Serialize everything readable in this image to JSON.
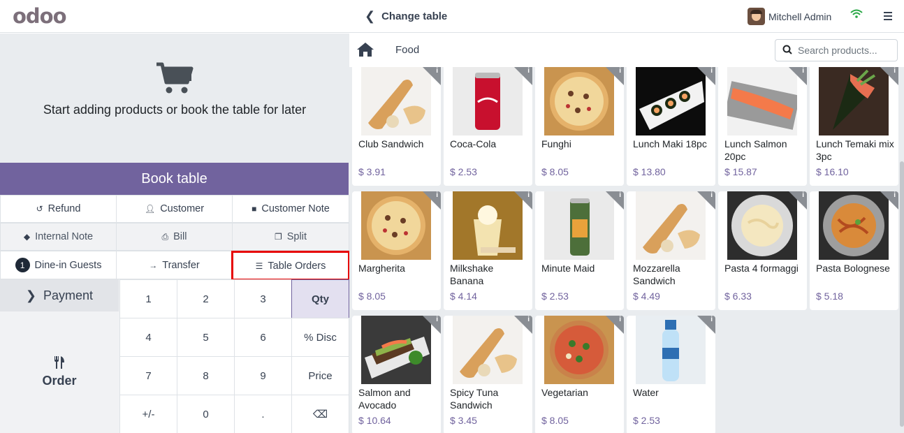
{
  "topbar": {
    "logo": "odoo",
    "change_table": "Change table",
    "user_name": "Mitchell Admin"
  },
  "empty_state": {
    "message": "Start adding products or book the table for later"
  },
  "book_table_label": "Book table",
  "controls": {
    "refund": "Refund",
    "customer": "Customer",
    "customer_note": "Customer Note",
    "internal_note": "Internal Note",
    "bill": "Bill",
    "split": "Split",
    "guests_count": "1",
    "dine_in_guests": "Dine-in Guests",
    "transfer": "Transfer",
    "table_orders": "Table Orders"
  },
  "payment_label": "Payment",
  "order_label": "Order",
  "numpad": {
    "keys": [
      "1",
      "2",
      "3",
      "Qty",
      "4",
      "5",
      "6",
      "% Disc",
      "7",
      "8",
      "9",
      "Price",
      "+/-",
      "0",
      ".",
      "⌫"
    ],
    "active_mode": "Qty"
  },
  "category": {
    "current": "Food"
  },
  "search": {
    "placeholder": "Search products..."
  },
  "colors": {
    "accent": "#71639e",
    "highlight_border": "#e60000",
    "wifi": "#28a745"
  },
  "products": [
    {
      "name": "Club Sandwich",
      "price": "$ 3.91",
      "img": "sandwich"
    },
    {
      "name": "Coca-Cola",
      "price": "$ 2.53",
      "img": "can-red"
    },
    {
      "name": "Funghi",
      "price": "$ 8.05",
      "img": "pizza"
    },
    {
      "name": "Lunch Maki 18pc",
      "price": "$ 13.80",
      "img": "sushi"
    },
    {
      "name": "Lunch Salmon 20pc",
      "price": "$ 15.87",
      "img": "salmon"
    },
    {
      "name": "Lunch Temaki mix 3pc",
      "price": "$ 16.10",
      "img": "temaki"
    },
    {
      "name": "Margherita",
      "price": "$ 8.05",
      "img": "pizza"
    },
    {
      "name": "Milkshake Banana",
      "price": "$ 4.14",
      "img": "milkshake"
    },
    {
      "name": "Minute Maid",
      "price": "$ 2.53",
      "img": "can-green"
    },
    {
      "name": "Mozzarella Sandwich",
      "price": "$ 4.49",
      "img": "sandwich"
    },
    {
      "name": "Pasta 4 formaggi",
      "price": "$ 6.33",
      "img": "pasta"
    },
    {
      "name": "Pasta Bolognese",
      "price": "$ 5.18",
      "img": "pasta-red"
    },
    {
      "name": "Salmon and Avocado",
      "price": "$ 10.64",
      "img": "salmon-avocado"
    },
    {
      "name": "Spicy Tuna Sandwich",
      "price": "$ 3.45",
      "img": "sandwich"
    },
    {
      "name": "Vegetarian",
      "price": "$ 8.05",
      "img": "pizza-green"
    },
    {
      "name": "Water",
      "price": "$ 2.53",
      "img": "water"
    }
  ]
}
